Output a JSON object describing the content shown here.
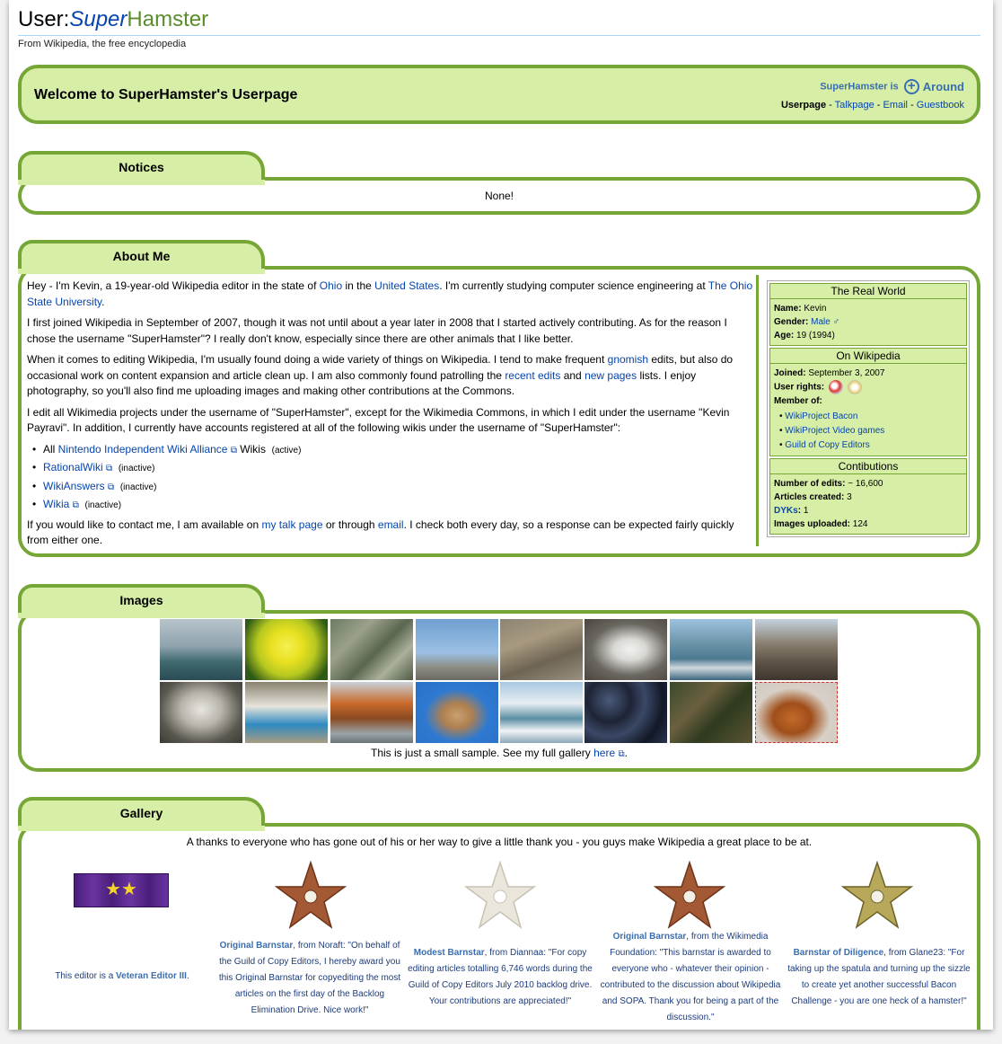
{
  "header": {
    "title_prefix": "User:",
    "title_super": "Super",
    "title_hamster": "Hamster",
    "tagline": "From Wikipedia, the free encyclopedia"
  },
  "welcome": {
    "title": "Welcome to SuperHamster's Userpage",
    "status_prefix": "SuperHamster is",
    "status_value": "Around",
    "nav_current": "Userpage",
    "nav_links": [
      "Talkpage",
      "Email",
      "Guestbook"
    ],
    "nav_sep": " - "
  },
  "notices": {
    "tab": "Notices",
    "text": "None!"
  },
  "about": {
    "tab": "About Me",
    "p1": [
      "Hey - I'm Kevin, a 19-year-old Wikipedia editor in the state of ",
      "Ohio",
      " in the ",
      "United States",
      ". I'm currently studying computer science engineering at ",
      "The Ohio State University",
      "."
    ],
    "p2": "I first joined Wikipedia in September of 2007, though it was not until about a year later in 2008 that I started actively contributing. As for the reason I chose the username \"SuperHamster\"? I really don't know, especially since there are other animals that I like better.",
    "p3": [
      "When it comes to editing Wikipedia, I'm usually found doing a wide variety of things on Wikipedia. I tend to make frequent ",
      "gnomish",
      " edits, but also do occasional work on content expansion and article clean up. I am also commonly found patrolling the ",
      "recent edits",
      " and ",
      "new pages",
      " lists. I enjoy photography, so you'll also find me uploading images and making other contributions at the Commons."
    ],
    "p4": "I edit all Wikimedia projects under the username of \"SuperHamster\", except for the Wikimedia Commons, in which I edit under the username \"Kevin Payravi\". In addition, I currently have accounts registered at all of the following wikis under the username of \"SuperHamster\":",
    "wikis": [
      {
        "pre": "All ",
        "name": "Nintendo Independent Wiki Alliance",
        "post": " Wikis",
        "status": "(active)"
      },
      {
        "pre": "",
        "name": "RationalWiki",
        "post": "",
        "status": "(inactive)"
      },
      {
        "pre": "",
        "name": "WikiAnswers",
        "post": "",
        "status": "(inactive)"
      },
      {
        "pre": "",
        "name": "Wikia",
        "post": "",
        "status": "(inactive)"
      }
    ],
    "p5": [
      "If you would like to contact me, I am available on ",
      "my talk page",
      " or through ",
      "email",
      ". I check both every day, so a response can be expected fairly quickly from either one."
    ]
  },
  "infobox": {
    "real_world": {
      "heading": "The Real World",
      "name_label": "Name:",
      "name": "Kevin",
      "gender_label": "Gender:",
      "gender": "Male",
      "gender_symbol": "♂",
      "age_label": "Age:",
      "age": "19 (1994)"
    },
    "on_wikipedia": {
      "heading": "On Wikipedia",
      "joined_label": "Joined:",
      "joined": "September 3, 2007",
      "rights_label": "User rights:",
      "member_label": "Member of:",
      "projects": [
        "WikiProject Bacon",
        "WikiProject Video games",
        "Guild of Copy Editors"
      ]
    },
    "contributions": {
      "heading": "Contibutions",
      "edits_label": "Number of edits:",
      "edits": "~ 16,600",
      "articles_label": "Articles created:",
      "articles": "3",
      "dyks_label": "DYKs",
      "dyks_sep": ":",
      "dyks": "1",
      "images_label": "Images uploaded:",
      "images": "124"
    }
  },
  "images": {
    "tab": "Images",
    "caption_text": "This is just a small sample. See my full gallery ",
    "caption_link": "here",
    "caption_end": ".",
    "thumbs": [
      "niagara-boat",
      "daffodil",
      "highway-interchange",
      "airplane",
      "gazelle",
      "swan",
      "marina",
      "tower",
      "goat-face",
      "goat-bucket",
      "autumn-trees",
      "capitol-dome",
      "niagara-falls",
      "blueberries",
      "lizard",
      "onion"
    ]
  },
  "gallery": {
    "tab": "Gallery",
    "intro": "A thanks to everyone who has gone out of his or her way to give a little thank you - you guys make Wikipedia a great place to be at.",
    "veteran": {
      "pre": "This editor is a ",
      "title": "Veteran Editor III",
      "post": "."
    },
    "awards": [
      {
        "title": "Original Barnstar",
        "text": ", from Noraft: \"On behalf of the Guild of Copy Editors, I hereby award you this Original Barnstar for copyediting the most articles on the first day of the Backlog Elimination Drive. Nice work!\""
      },
      {
        "title": "Modest Barnstar",
        "text": ", from Diannaa: \"For copy editing articles totalling 6,746 words during the Guild of Copy Editors July 2010 backlog drive. Your contributions are appreciated!\""
      },
      {
        "title": "Original Barnstar",
        "text": ", from the Wikimedia Foundation: \"This barnstar is awarded to everyone who - whatever their opinion - contributed to the discussion about Wikipedia and SOPA. Thank you for being a part of the discussion.\""
      },
      {
        "title": "Barnstar of Diligence",
        "text": ", from Glane23: \"For taking up the spatula and turning up the sizzle to create yet another successful Bacon Challenge - you are one heck of a hamster!\""
      }
    ]
  },
  "colors": {
    "border_green": "#76a636",
    "fill_green": "#d7eea7",
    "link_blue": "#0645ad"
  }
}
